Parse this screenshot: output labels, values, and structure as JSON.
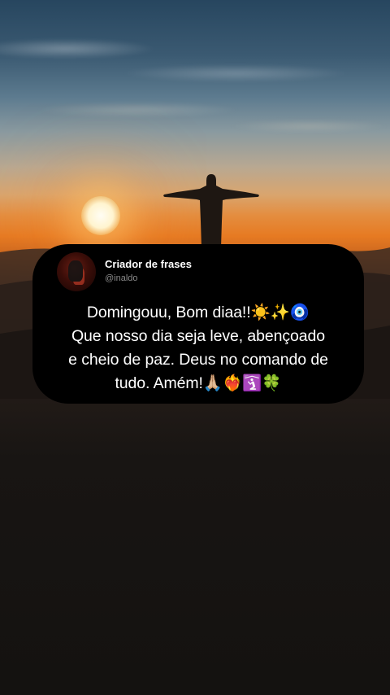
{
  "card": {
    "author_name": "Criador de frases",
    "author_handle": "@inaldo",
    "message_lines": [
      "Domingouu, Bom diaa!!☀️✨🧿",
      "Que nosso dia seja leve, abençoado",
      "e cheio de paz. Deus no comando de",
      "tudo. Amém!🙏🏼❤️‍🔥🛐🍀"
    ]
  },
  "background": {
    "scene": "sunset",
    "colors": {
      "sky_top": "#27465f",
      "horizon": "#e67a22",
      "ground": "#141210"
    }
  },
  "icons": [
    "sun",
    "christ-statue-silhouette",
    "avatar"
  ]
}
